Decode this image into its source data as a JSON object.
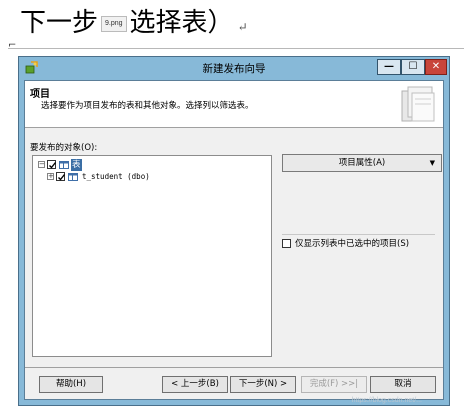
{
  "document": {
    "heading_prefix": "下一步",
    "image_chip": "9.png",
    "heading_suffix": "选择表）",
    "return_mark": "↵"
  },
  "window": {
    "title": "新建发布向导",
    "controls": {
      "minimize": "—",
      "maximize": "☐",
      "close": "✕"
    }
  },
  "header": {
    "title": "项目",
    "description": "选择要作为项目发布的表和其他对象。选择列以筛选表。"
  },
  "objects": {
    "label": "要发布的对象(O):",
    "tree": [
      {
        "label": "表",
        "checked": true,
        "expanded": true,
        "selected": true
      },
      {
        "label": "t_student (dbo)",
        "checked": true,
        "expanded": false,
        "selected": false
      }
    ]
  },
  "properties": {
    "dropdown_label": "项目属性(A)",
    "dropdown_arrow": "▼"
  },
  "options": {
    "only_selected_label": "仅显示列表中已选中的项目(S)",
    "only_selected_checked": false
  },
  "buttons": {
    "help": "帮助(H)",
    "back": "< 上一步(B)",
    "next": "下一步(N) >",
    "finish": "完成(F) >>|",
    "cancel": "取消"
  },
  "watermark": "https://blog.csdn.net/..."
}
